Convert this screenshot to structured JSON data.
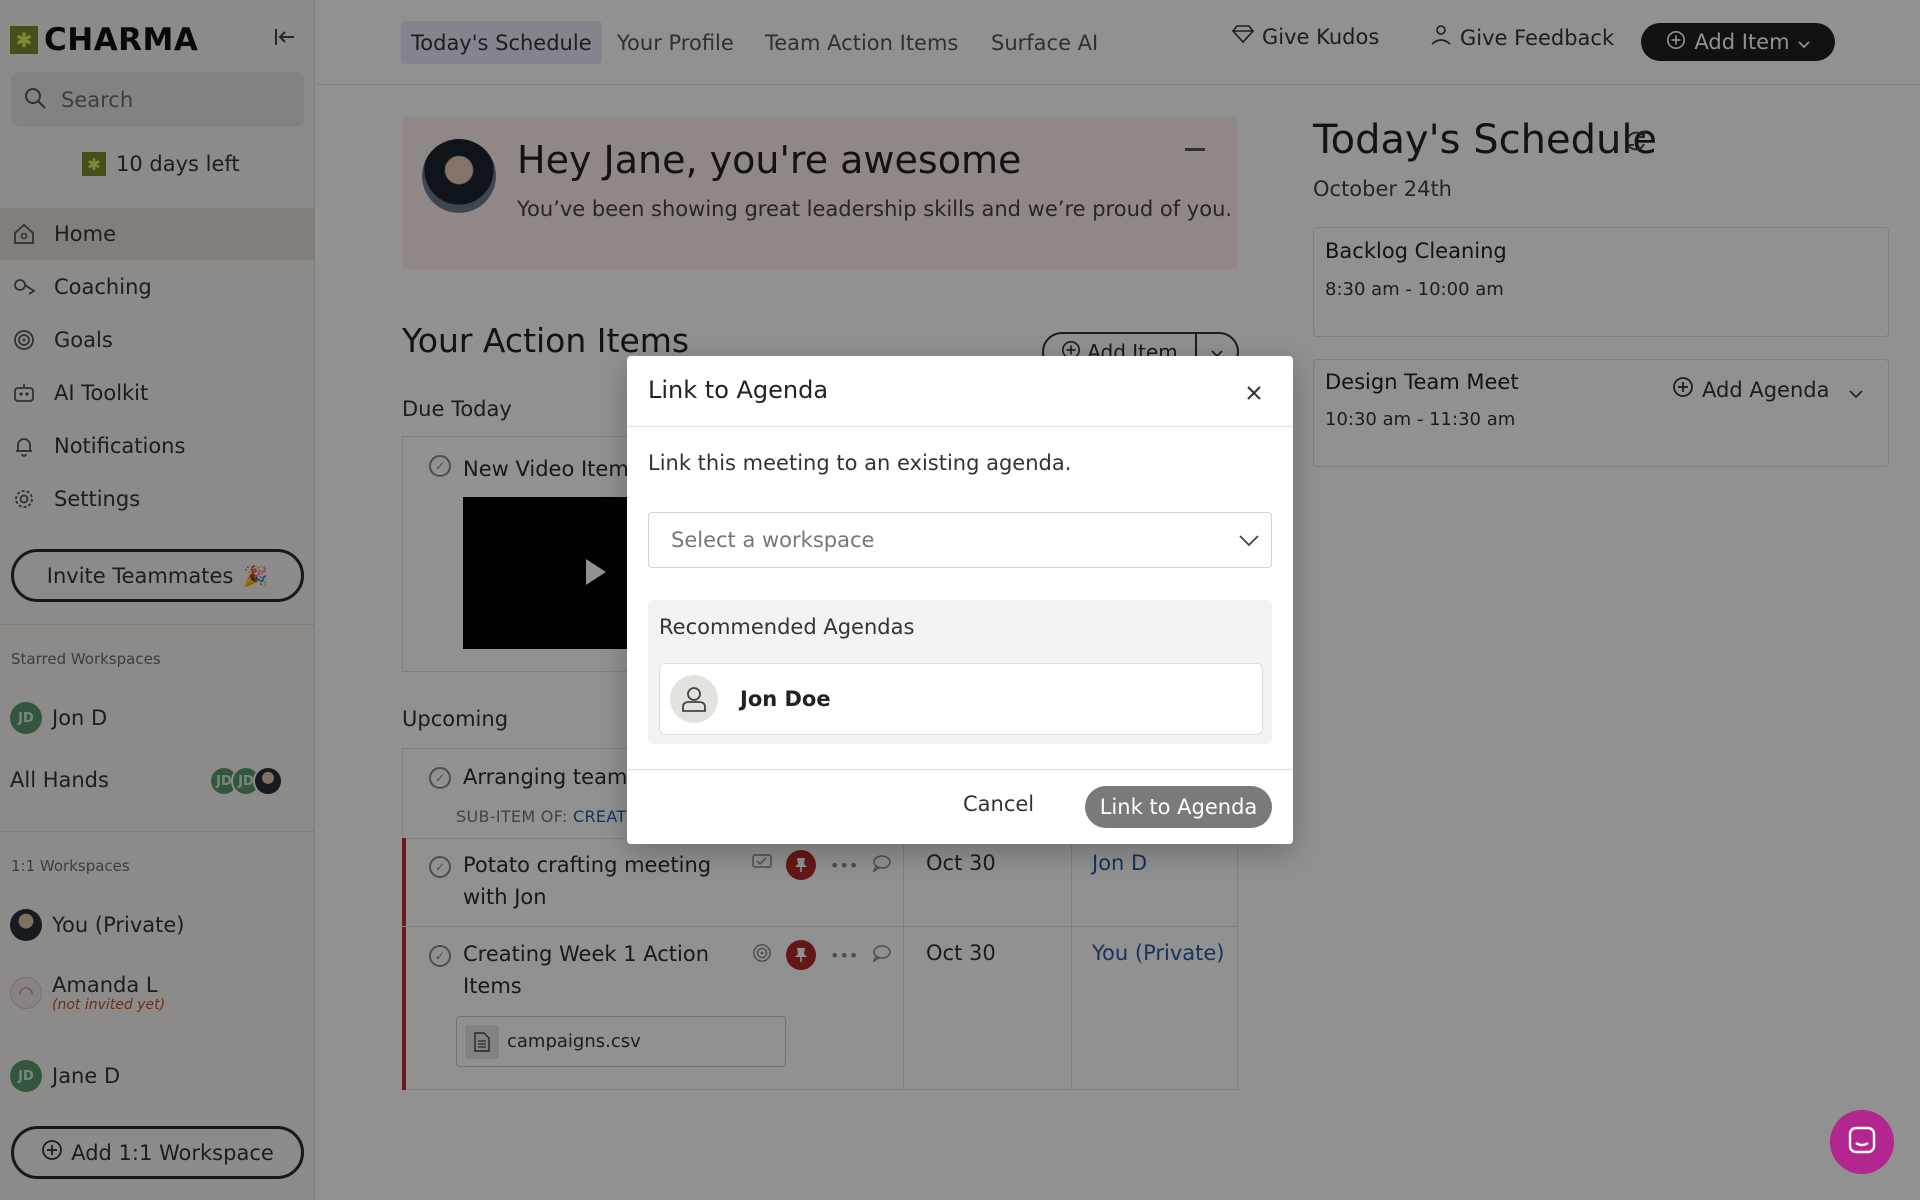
{
  "app": {
    "name": "CHARMA"
  },
  "sidebar": {
    "search_placeholder": "Search",
    "trial_text": "10 days left",
    "nav": [
      {
        "label": "Home",
        "icon": "home-icon"
      },
      {
        "label": "Coaching",
        "icon": "coaching-icon"
      },
      {
        "label": "Goals",
        "icon": "target-icon"
      },
      {
        "label": "AI Toolkit",
        "icon": "robot-icon"
      },
      {
        "label": "Notifications",
        "icon": "bell-icon"
      },
      {
        "label": "Settings",
        "icon": "gear-icon"
      }
    ],
    "invite_label": "Invite Teammates",
    "starred_label": "Starred Workspaces",
    "starred": [
      {
        "name": "Jon D",
        "initials": "JD"
      },
      {
        "name": "All Hands",
        "initials": "JD"
      }
    ],
    "oneone_label": "1:1 Workspaces",
    "oneone": [
      {
        "name": "You (Private)"
      },
      {
        "name": "Amanda L",
        "note": "(not invited yet)"
      },
      {
        "name": "Jane D",
        "initials": "JD"
      }
    ],
    "add_ws_label": "Add 1:1 Workspace"
  },
  "topbar": {
    "tabs": [
      "Today's Schedule",
      "Your Profile",
      "Team Action Items",
      "Surface AI"
    ],
    "give_kudos": "Give Kudos",
    "give_feedback": "Give Feedback",
    "add_item": "Add Item"
  },
  "kudos": {
    "title": "Hey Jane, you're awesome",
    "message": "You’ve been showing great leadership skills and we’re proud of you."
  },
  "action_items": {
    "heading": "Your Action Items",
    "add_item": "Add Item",
    "due_today_label": "Due Today",
    "due_today": [
      {
        "title": "New Video Item"
      }
    ],
    "upcoming_label": "Upcoming",
    "upcoming": [
      {
        "title": "Arranging team c",
        "sub_item_prefix": "SUB-ITEM OF:",
        "sub_item_link": "CREAT"
      },
      {
        "title": "Potato crafting meeting with Jon",
        "date": "Oct 30",
        "owner": "Jon D"
      },
      {
        "title": "Creating Week 1 Action Items",
        "date": "Oct 30",
        "owner": "You (Private)",
        "attachment": "campaigns.csv"
      }
    ]
  },
  "schedule": {
    "title": "Today's Schedule",
    "date": "October 24th",
    "events": [
      {
        "name": "Backlog Cleaning",
        "time": "8:30 am - 10:00 am"
      },
      {
        "name": "Design Team Meet",
        "time": "10:30 am - 11:30 am",
        "action": "Add Agenda"
      }
    ]
  },
  "modal": {
    "title": "Link to Agenda",
    "description": "Link this meeting to an existing agenda.",
    "select_placeholder": "Select a workspace",
    "recommended_label": "Recommended Agendas",
    "recommended": [
      {
        "name": "Jon Doe"
      }
    ],
    "cancel": "Cancel",
    "confirm": "Link to Agenda"
  },
  "colors": {
    "accent": "#b3268f",
    "link": "#2a58a8",
    "pin": "#b22a2a",
    "overdue_bar": "#c0302f"
  }
}
